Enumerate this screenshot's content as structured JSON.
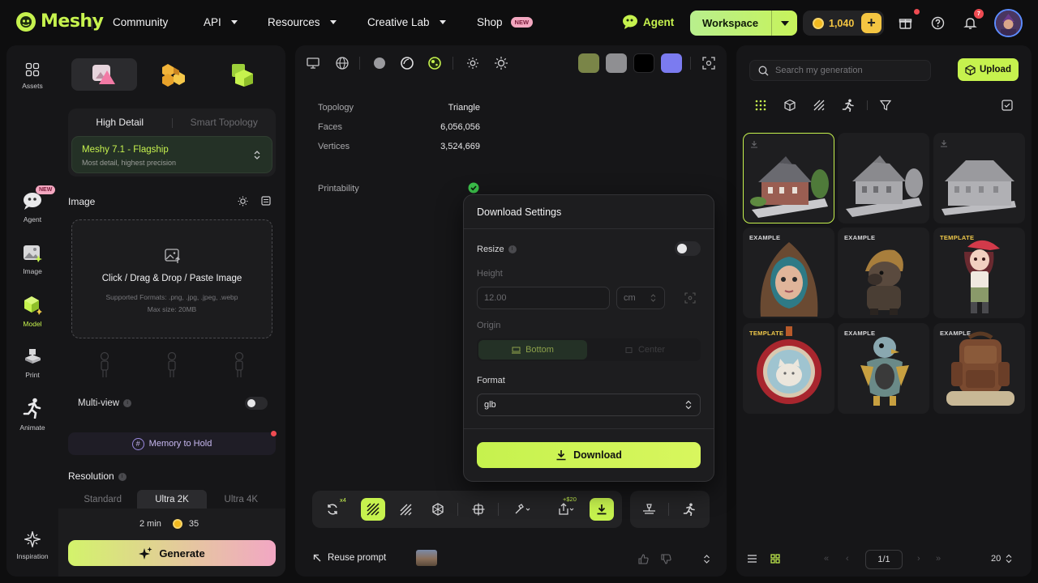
{
  "app": {
    "name": "Meshy"
  },
  "nav": {
    "community": "Community",
    "api": "API",
    "resources": "Resources",
    "creative_lab": "Creative Lab",
    "shop": "Shop",
    "shop_badge": "NEW"
  },
  "topbar": {
    "agent": "Agent",
    "workspace": "Workspace",
    "credits": "1,040",
    "notifications_count": "7"
  },
  "rail": {
    "assets": "Assets",
    "agent": "Agent",
    "agent_badge": "NEW",
    "image": "Image",
    "model": "Model",
    "print": "Print",
    "animate": "Animate",
    "inspiration": "Inspiration"
  },
  "left": {
    "modes": [
      "High Detail",
      "Smart Topology"
    ],
    "model_name": "Meshy 7.1 - Flagship",
    "model_desc": "Most detail, highest precision",
    "image_section": "Image",
    "drop_main": "Click / Drag & Drop / Paste Image",
    "drop_formats": "Supported Formats: .png, .jpg, .jpeg, .webp",
    "drop_size": "Max size: 20MB",
    "multiview": "Multi-view",
    "memory": "Memory to Hold",
    "resolution": "Resolution",
    "res_options": [
      "Standard",
      "Ultra 2K",
      "Ultra 4K"
    ],
    "time": "2 min",
    "cost": "35",
    "generate": "Generate"
  },
  "viewer": {
    "stats": [
      {
        "label": "Topology",
        "value": "Triangle"
      },
      {
        "label": "Faces",
        "value": "6,056,056"
      },
      {
        "label": "Vertices",
        "value": "3,524,669"
      }
    ],
    "printability": "Printability",
    "remesh_badge": "x4",
    "export_badge": "+$20",
    "reuse_prompt": "Reuse prompt"
  },
  "colors": {
    "accent": "#c6f24e",
    "swatch_olive": "#7a8548",
    "swatch_gray": "#8f8f92",
    "swatch_black": "#000000",
    "swatch_violet": "#7b7bf0"
  },
  "dialog": {
    "title": "Download Settings",
    "resize": "Resize",
    "height": "Height",
    "height_value": "12.00",
    "unit": "cm",
    "origin": "Origin",
    "origin_bottom": "Bottom",
    "origin_center": "Center",
    "format": "Format",
    "format_value": "glb",
    "download": "Download"
  },
  "right": {
    "search_placeholder": "Search my generation",
    "upload": "Upload",
    "tags": [
      "",
      "",
      "",
      "EXAMPLE",
      "EXAMPLE",
      "TEMPLATE",
      "TEMPLATE",
      "EXAMPLE",
      "EXAMPLE"
    ],
    "page": "1/1",
    "per_page": "20"
  }
}
